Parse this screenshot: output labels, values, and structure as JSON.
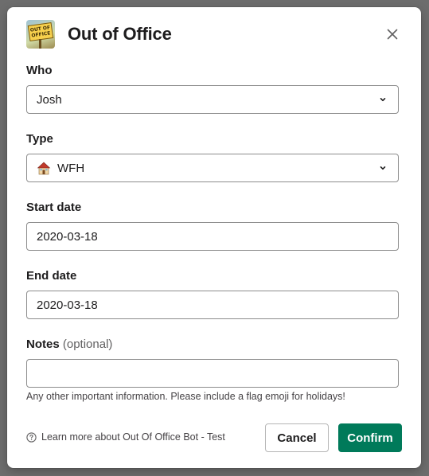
{
  "modal": {
    "title": "Out of Office",
    "logo_text": "OUT OF OFFICE",
    "close_icon": "close-icon"
  },
  "fields": {
    "who": {
      "label": "Who",
      "value": "Josh"
    },
    "type": {
      "label": "Type",
      "value": "WFH",
      "icon": "house-emoji"
    },
    "start_date": {
      "label": "Start date",
      "value": "2020-03-18"
    },
    "end_date": {
      "label": "End date",
      "value": "2020-03-18"
    },
    "notes": {
      "label": "Notes",
      "label_suffix": "(optional)",
      "value": "",
      "hint": "Any other important information. Please include a flag emoji for holidays!"
    }
  },
  "footer": {
    "help_link": "Learn more about Out Of Office Bot - Test",
    "cancel_label": "Cancel",
    "confirm_label": "Confirm"
  },
  "colors": {
    "confirm_button": "#007a5a",
    "backdrop": "#6d6d6d"
  }
}
